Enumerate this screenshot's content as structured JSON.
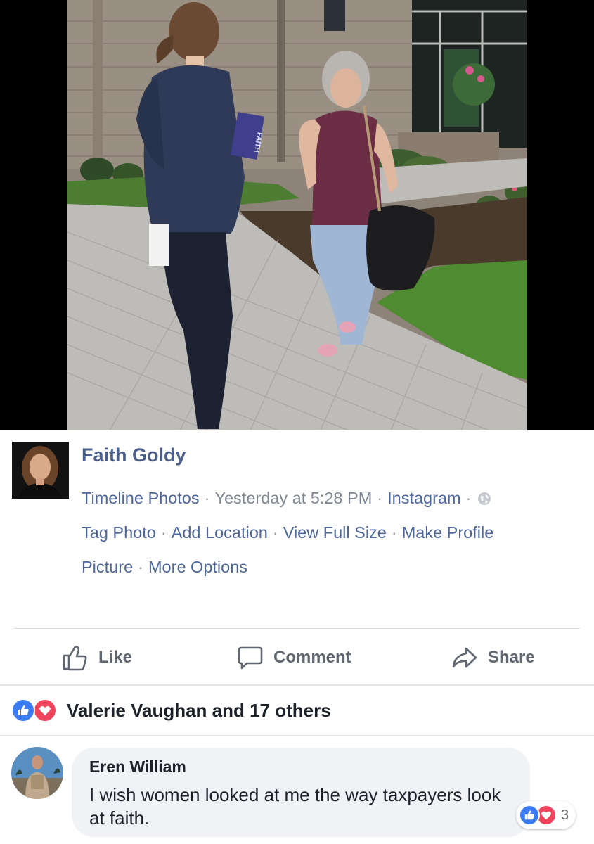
{
  "post": {
    "author": "Faith Goldy",
    "meta_line_1": {
      "album": "Timeline Photos",
      "time": "Yesterday at 5:28 PM",
      "source": "Instagram",
      "privacy_icon": "globe-icon"
    },
    "options": {
      "tag_photo": "Tag Photo",
      "add_location": "Add Location",
      "view_full_size": "View Full Size",
      "make_profile_picture": "Make Profile Picture",
      "more_options": "More Options"
    },
    "separator": "·",
    "photo_pamphlet_text": "FAITH"
  },
  "actions": {
    "like": "Like",
    "comment": "Comment",
    "share": "Share"
  },
  "reactions": {
    "icons": [
      "like-icon",
      "love-icon"
    ],
    "summary": "Valerie Vaughan and 17 others"
  },
  "comment": {
    "author": "Eren William",
    "text": "I wish women looked at me the way taxpayers look at faith.",
    "reaction_count": "3",
    "reaction_icons": [
      "like-icon",
      "love-icon"
    ]
  },
  "colors": {
    "link": "#4e6699",
    "like_blue": "#3b7cf3",
    "love_red": "#f0445c",
    "action_gray": "#606770"
  }
}
